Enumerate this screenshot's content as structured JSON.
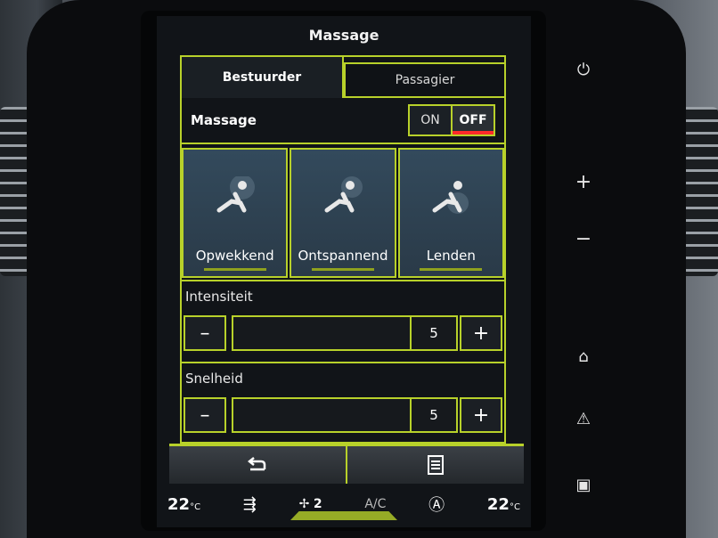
{
  "screen": {
    "title": "Massage",
    "tabs": [
      {
        "label": "Bestuurder",
        "active": true
      },
      {
        "label": "Passagier",
        "active": false
      }
    ],
    "massage_toggle": {
      "label": "Massage",
      "on_label": "ON",
      "off_label": "OFF",
      "state": "OFF"
    },
    "modes": [
      {
        "label": "Opwekkend",
        "icon": "seat-massage-icon"
      },
      {
        "label": "Ontspannend",
        "icon": "seat-massage-icon"
      },
      {
        "label": "Lenden",
        "icon": "seat-massage-icon"
      }
    ],
    "intensity": {
      "label": "Intensiteit",
      "value": "5",
      "minus": "–",
      "plus": "+"
    },
    "speed": {
      "label": "Snelheid",
      "value": "5",
      "minus": "–",
      "plus": "+"
    },
    "bottom": {
      "back_icon": "back-arrow-icon",
      "menu_icon": "list-icon"
    },
    "climate": {
      "left_temp": "22",
      "right_temp": "22",
      "temp_unit": "°C",
      "fan_level": "2",
      "ac_label": "A/C"
    }
  },
  "side_buttons": [
    "power-icon",
    "plus-icon",
    "minus-icon",
    "home-icon",
    "hazard-icon",
    "screen-icon"
  ],
  "colors": {
    "accent": "#b8d12a",
    "off_indicator": "#ff2a2a"
  }
}
